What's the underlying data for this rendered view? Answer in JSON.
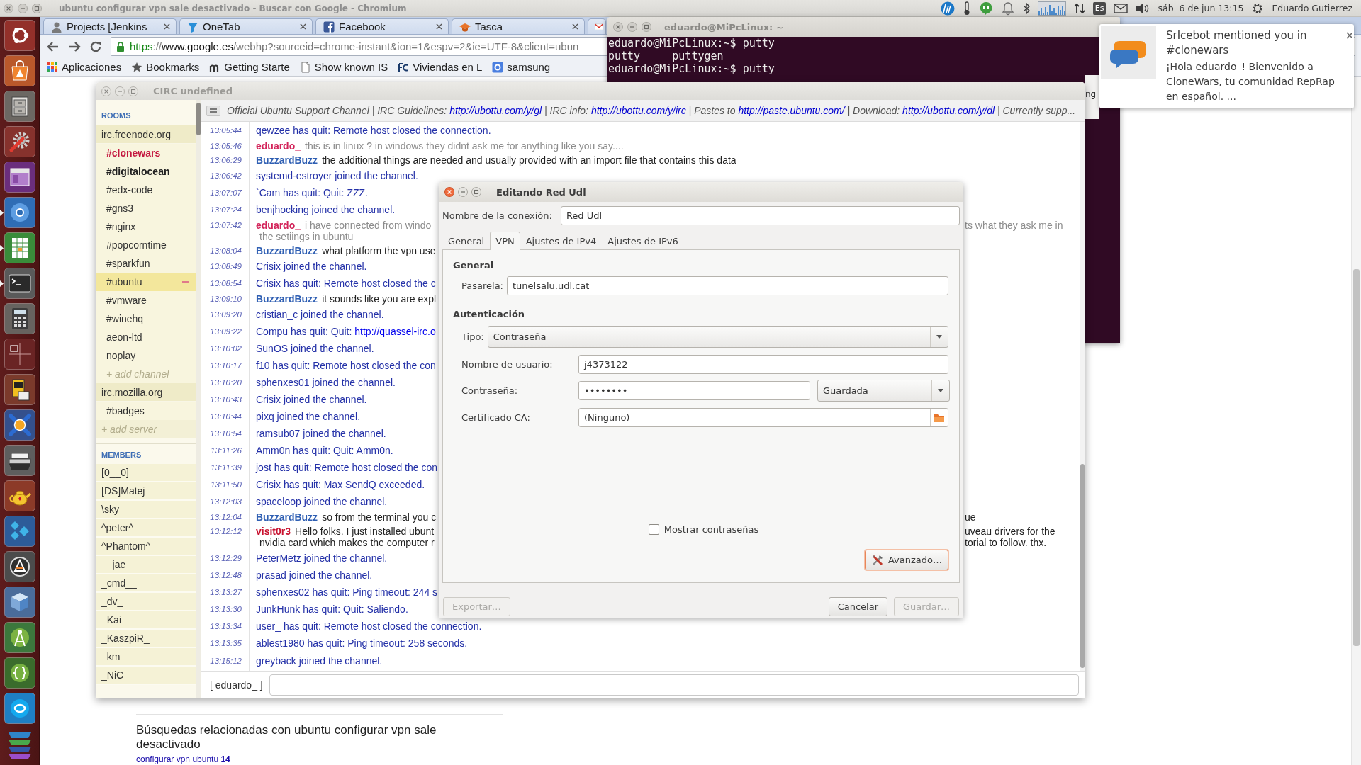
{
  "top_panel": {
    "window_title": "ubuntu configurar vpn sale desactivado - Buscar con Google - Chromium",
    "keyboard_layout": "Es",
    "clock": "sáb  6 de jun 13:15",
    "user": "Eduardo Gutierrez"
  },
  "launcher": {
    "items": [
      {
        "kind": "dash",
        "running": false
      },
      {
        "kind": "software",
        "running": false
      },
      {
        "kind": "files",
        "running": false
      },
      {
        "kind": "settings",
        "running": false
      },
      {
        "kind": "window",
        "running": false
      },
      {
        "kind": "browser",
        "running": true
      },
      {
        "kind": "spreadsheet",
        "running": true
      },
      {
        "kind": "terminal",
        "running": true
      },
      {
        "kind": "calculator",
        "running": false
      },
      {
        "kind": "workspaces",
        "running": false
      },
      {
        "kind": "card",
        "running": false
      },
      {
        "kind": "globe",
        "running": false
      },
      {
        "kind": "scanner",
        "running": false
      },
      {
        "kind": "teapot",
        "running": false
      },
      {
        "kind": "kite",
        "running": false
      },
      {
        "kind": "update",
        "running": false
      },
      {
        "kind": "cube",
        "running": false
      },
      {
        "kind": "compass",
        "running": false
      },
      {
        "kind": "braces",
        "running": false
      },
      {
        "kind": "chat",
        "running": false
      },
      {
        "kind": "stack",
        "running": false
      }
    ]
  },
  "browser": {
    "tabs": [
      {
        "kind": "person",
        "title": "Projects [Jenkins"
      },
      {
        "kind": "funnel",
        "title": "OneTab"
      },
      {
        "kind": "square",
        "title": "Facebook"
      },
      {
        "kind": "cap",
        "title": "Tasca"
      },
      {
        "kind": "mail"
      }
    ],
    "url": {
      "scheme": "https",
      "separator": "://",
      "host": "www.google.es",
      "path": "/webhp?sourceid=chrome-instant&ion=1&espv=2&ie=UTF-8&client=ubun"
    },
    "bookmarks": [
      {
        "kind": "apps",
        "label": "Aplicaciones"
      },
      {
        "kind": "star",
        "label": "Bookmarks"
      },
      {
        "kind": "arches",
        "label": "Getting Starte"
      },
      {
        "kind": "page",
        "label": "Show known IS"
      },
      {
        "kind": "site",
        "label": "Viviendas en L"
      },
      {
        "kind": "tile",
        "label": "samsung"
      }
    ],
    "page": {
      "related_heading": "Búsquedas relacionadas con ubuntu configurar vpn sale desactivado",
      "related_links": [
        "configurar vpn ubuntu **14**"
      ]
    }
  },
  "terminal": {
    "title": "eduardo@MiPcLinux: ~",
    "lines": [
      "eduardo@MiPcLinux:~$ putty",
      "putty     puttygen",
      "eduardo@MiPcLinux:~$ putty"
    ]
  },
  "background_window": {
    "text": "ng"
  },
  "notification": {
    "title": "SrIcebot mentioned you in #clonewars",
    "body": "¡Hola eduardo_! Bienvenido a CloneWars, tu comunidad RepRap en español. ..."
  },
  "circ": {
    "title": "CIRC undefined",
    "rooms": {
      "title": "ROOMS",
      "servers": [
        {
          "name": "irc.freenode.org",
          "selected": false,
          "children": [
            {
              "name": "#clonewars",
              "selected": false,
              "mention": true,
              "unread": false
            },
            {
              "name": "#digitalocean",
              "selected": false,
              "mention": false,
              "unread": true
            },
            {
              "name": "#edx-code",
              "selected": false,
              "mention": false,
              "unread": false
            },
            {
              "name": "#gns3",
              "selected": false,
              "mention": false,
              "unread": false
            },
            {
              "name": "#nginx",
              "selected": false,
              "mention": false,
              "unread": false
            },
            {
              "name": "#popcorntime",
              "selected": false,
              "mention": false,
              "unread": false
            },
            {
              "name": "#sparkfun",
              "selected": false,
              "mention": false,
              "unread": false
            },
            {
              "name": "#ubuntu",
              "selected": true,
              "mention": false,
              "unread": false
            },
            {
              "name": "#vmware",
              "selected": false,
              "mention": false,
              "unread": false
            },
            {
              "name": "#winehq",
              "selected": false,
              "mention": false,
              "unread": false
            },
            {
              "name": "aeon-ltd",
              "selected": false,
              "mention": false,
              "unread": false
            },
            {
              "name": "noplay",
              "selected": false,
              "mention": false,
              "unread": false
            }
          ],
          "add_label": "+ add channel"
        },
        {
          "name": "irc.mozilla.org",
          "selected": false,
          "children": [
            {
              "name": "#badges",
              "selected": false,
              "mention": false,
              "unread": false
            }
          ]
        }
      ],
      "add_label": "+ add server"
    },
    "members": {
      "title": "MEMBERS",
      "names": [
        "[0__0]",
        "[DS]Matej",
        "\\sky",
        "^peter^",
        "^Phantom^",
        "__jae__",
        "_cmd__",
        "_dv_",
        "_Kai_",
        "_KaszpiR_",
        "_km",
        "_NiC"
      ]
    },
    "topic": [
      {
        "kind": "text",
        "text": "Official Ubuntu Support Channel | IRC Guidelines: "
      },
      {
        "kind": "link",
        "text": "http://ubottu.com/y/gl"
      },
      {
        "kind": "text",
        "text": " | IRC info: "
      },
      {
        "kind": "link",
        "text": "http://ubottu.com/y/irc"
      },
      {
        "kind": "text",
        "text": " | Pastes to "
      },
      {
        "kind": "link",
        "text": "http://paste.ubuntu.com/"
      },
      {
        "kind": "text",
        "text": " | Download: "
      },
      {
        "kind": "link",
        "text": "http://ubottu.com/y/dl"
      },
      {
        "kind": "text",
        "text": " | Currently supp..."
      }
    ],
    "messages": [
      {
        "time": "13:05:44",
        "kind": "notice",
        "lines": [
          {
            "text": "qewzee has quit: Remote host closed the connection."
          }
        ]
      },
      {
        "time": "13:05:46",
        "kind": "own",
        "nick": "eduardo_",
        "color": "#d3245a",
        "lines": [
          {
            "text": "this is in linux ? in windows they didnt ask me for anything like you say...."
          }
        ]
      },
      {
        "time": "13:06:29",
        "kind": "message",
        "nick": "BuzzardBuzz",
        "color": "#2f5fb3",
        "lines": [
          {
            "text": "the additional things are needed and usually provided with an import file that contains this data"
          }
        ]
      },
      {
        "time": "13:06:42",
        "kind": "notice",
        "lines": [
          {
            "text": "systemd-estroyer joined the channel."
          }
        ]
      },
      {
        "time": "13:07:07",
        "kind": "notice",
        "lines": [
          {
            "text": "`Cam has quit: Quit: ZZZ."
          }
        ]
      },
      {
        "time": "13:07:24",
        "kind": "notice",
        "lines": [
          {
            "text": "benjhocking joined the channel."
          }
        ]
      },
      {
        "time": "13:07:42",
        "kind": "own",
        "nick": "eduardo_",
        "color": "#d3245a",
        "lines": [
          {
            "text": "i have connected from windo",
            "text_right": "ts what they ask me in"
          },
          {
            "text": "the setiings in ubuntu"
          }
        ]
      },
      {
        "time": "13:08:04",
        "kind": "message",
        "nick": "BuzzardBuzz",
        "color": "#2f5fb3",
        "lines": [
          {
            "text": "what platform the vpn use"
          }
        ]
      },
      {
        "time": "13:08:49",
        "kind": "notice",
        "lines": [
          {
            "text": "Crisix joined the channel."
          }
        ]
      },
      {
        "time": "13:08:54",
        "kind": "notice",
        "lines": [
          {
            "text": "Crisix has quit: Remote host closed the c"
          }
        ]
      },
      {
        "time": "13:09:10",
        "kind": "message",
        "nick": "BuzzardBuzz",
        "color": "#2f5fb3",
        "lines": [
          {
            "text": "it sounds like you are expl"
          }
        ]
      },
      {
        "time": "13:09:20",
        "kind": "notice",
        "lines": [
          {
            "text": "cristian_c joined the channel."
          }
        ]
      },
      {
        "time": "13:09:22",
        "kind": "notice",
        "lines": [
          {
            "text": "Compu has quit: Quit: ",
            "link": "http://quassel-irc.o"
          }
        ]
      },
      {
        "time": "13:10:02",
        "kind": "notice",
        "lines": [
          {
            "text": "SunOS joined the channel."
          }
        ]
      },
      {
        "time": "13:10:17",
        "kind": "notice",
        "lines": [
          {
            "text": "f10 has quit: Remote host closed the con"
          }
        ]
      },
      {
        "time": "13:10:20",
        "kind": "notice",
        "lines": [
          {
            "text": "sphenxes01 joined the channel."
          }
        ]
      },
      {
        "time": "13:10:43",
        "kind": "notice",
        "lines": [
          {
            "text": "Crisix joined the channel."
          }
        ]
      },
      {
        "time": "13:10:44",
        "kind": "notice",
        "lines": [
          {
            "text": "pixq joined the channel."
          }
        ]
      },
      {
        "time": "13:10:54",
        "kind": "notice",
        "lines": [
          {
            "text": "ramsub07 joined the channel."
          }
        ]
      },
      {
        "time": "13:11:26",
        "kind": "notice",
        "lines": [
          {
            "text": "Amm0n has quit: Quit: Amm0n."
          }
        ]
      },
      {
        "time": "13:11:39",
        "kind": "notice",
        "lines": [
          {
            "text": "jost has quit: Remote host closed the con"
          }
        ]
      },
      {
        "time": "13:11:50",
        "kind": "notice",
        "lines": [
          {
            "text": "Crisix has quit: Max SendQ exceeded."
          }
        ]
      },
      {
        "time": "13:12:03",
        "kind": "notice",
        "lines": [
          {
            "text": "spaceloop joined the channel."
          }
        ]
      },
      {
        "time": "13:12:04",
        "kind": "message",
        "nick": "BuzzardBuzz",
        "color": "#2f5fb3",
        "lines": [
          {
            "text": "so from the terminal you c",
            "text_right": "ue"
          }
        ]
      },
      {
        "time": "13:12:12",
        "kind": "message",
        "nick": "visit0r3",
        "color": "#c8102e",
        "lines": [
          {
            "text": "Hello folks. I just installed ubunt",
            "text_right": "uveau drivers for the"
          },
          {
            "text": "nvidia card which makes the computer r",
            "text_right": "torial to follow. thx."
          }
        ]
      },
      {
        "time": "13:12:29",
        "kind": "notice",
        "lines": [
          {
            "text": "PeterMetz joined the channel."
          }
        ]
      },
      {
        "time": "13:12:48",
        "kind": "notice",
        "lines": [
          {
            "text": "prasad joined the channel."
          }
        ]
      },
      {
        "time": "13:13:27",
        "kind": "notice",
        "lines": [
          {
            "text": "sphenxes02 has quit: Ping timeout: 244 s"
          }
        ]
      },
      {
        "time": "13:13:30",
        "kind": "notice",
        "lines": [
          {
            "text": "JunkHunk has quit: Quit: Saliendo."
          }
        ]
      },
      {
        "time": "13:13:34",
        "kind": "notice",
        "lines": [
          {
            "text": "user_ has quit: Remote host closed the connection."
          }
        ]
      },
      {
        "time": "13:13:35",
        "kind": "notice",
        "lines": [
          {
            "text": "ablest1980 has quit: Ping timeout: 258 seconds."
          }
        ]
      },
      {
        "kind": "unread-line"
      },
      {
        "time": "13:15:12",
        "kind": "notice",
        "lines": [
          {
            "text": "greyback joined the channel."
          }
        ]
      }
    ],
    "nick_label": "[ eduardo_ ]"
  },
  "dialog": {
    "title": "Editando Red Udl",
    "connection_label": "Nombre de la conexión:",
    "connection_value": "Red Udl",
    "tabs": [
      {
        "label": "General",
        "selected": false
      },
      {
        "label": "VPN",
        "selected": true
      },
      {
        "label": "Ajustes de IPv4",
        "selected": false
      },
      {
        "label": "Ajustes de IPv6",
        "selected": false
      }
    ],
    "general_heading": "General",
    "gateway_label": "Pasarela:",
    "gateway_value": "tunelsalu.udl.cat",
    "auth_heading": "Autenticación",
    "type_label": "Tipo:",
    "type_value": "Contraseña",
    "user_label": "Nombre de usuario:",
    "user_value": "j4373122",
    "password_label": "Contraseña:",
    "password_value": "••••••••",
    "password_storage": "Guardada",
    "ca_label": "Certificado CA:",
    "ca_value": "(Ninguno)",
    "show_passwords": {
      "label": "Mostrar contraseñas",
      "checked": false
    },
    "advanced_button": {
      "label": "Avanzado…",
      "focused": true
    },
    "buttons": [
      {
        "label": "Exportar…",
        "disabled": true
      },
      {
        "label": "Cancelar",
        "disabled": false
      },
      {
        "label": "Guardar…",
        "disabled": true
      }
    ]
  }
}
